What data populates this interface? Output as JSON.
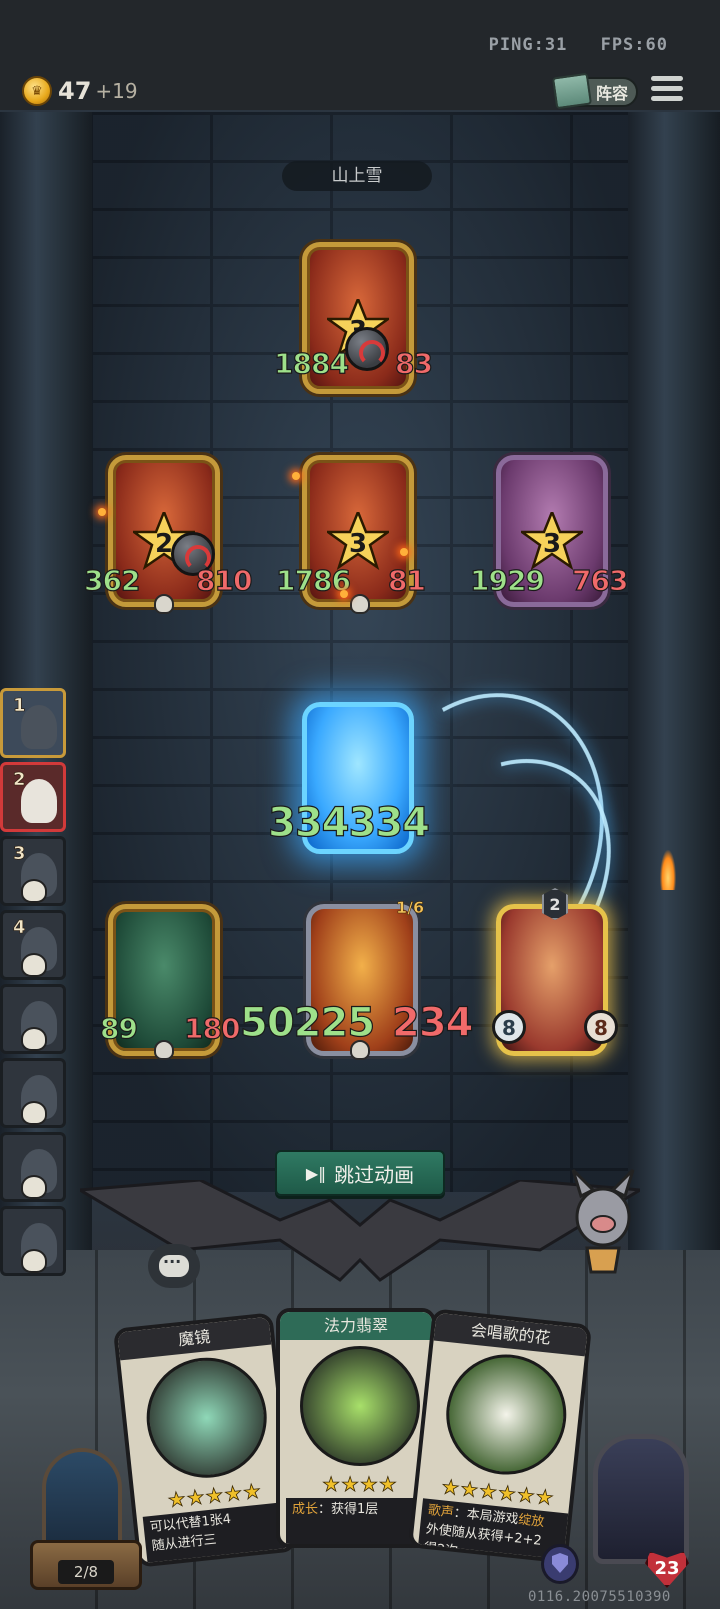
{
  "network": {
    "ping": "PING:31",
    "fps": "FPS:60"
  },
  "gold": {
    "value": "47",
    "income": "+19"
  },
  "header": {
    "lineup_label": "阵容"
  },
  "stage": {
    "name": "山上雪"
  },
  "enemies": [
    {
      "tier": "3",
      "attack": "1884",
      "health": "83"
    },
    {
      "tier": "2",
      "attack": "362",
      "health": "810"
    },
    {
      "tier": "3",
      "attack": "1786",
      "health": "81"
    },
    {
      "tier": "3",
      "attack": "1929",
      "health": "763"
    }
  ],
  "frozen_card": {
    "damage": "334334"
  },
  "allies": [
    {
      "attack": "89",
      "health": "180"
    },
    {
      "attack": "50225",
      "health": "234",
      "counter": "1/6"
    },
    {
      "attack": "8",
      "health": "8",
      "level": "2"
    }
  ],
  "roster": [
    {
      "num": "1",
      "state": "active"
    },
    {
      "num": "2",
      "state": "selected"
    },
    {
      "num": "3",
      "state": "dead"
    },
    {
      "num": "4",
      "state": "dead"
    },
    {
      "num": "",
      "state": "dead"
    },
    {
      "num": "",
      "state": "dead"
    },
    {
      "num": "",
      "state": "dead"
    },
    {
      "num": "",
      "state": "dead"
    }
  ],
  "skip_button": {
    "label": "跳过动画",
    "icon": "play-pause-icon"
  },
  "hand": [
    {
      "title": "魔镜",
      "stars": "★★★★★",
      "text_1": "可以代替1张4",
      "text_2": "随从进行三"
    },
    {
      "title": "法力翡翠",
      "stars": "★★★★",
      "keyword": "成长",
      "text_1": "：获得1层"
    },
    {
      "title": "会唱歌的花",
      "stars": "★★★★★★",
      "keyword": "歌声",
      "text_1": "：本局游戏",
      "keyword_2": "绽放",
      "text_2": "外使随从获得+2+2",
      "text_3": "得2次"
    }
  ],
  "deck": {
    "count": "2/8"
  },
  "hero": {
    "health": "23"
  },
  "build": {
    "id": "0116.20075510390"
  },
  "colors": {
    "attack": "#9ee08a",
    "health": "#f06a6a",
    "accent_gold": "#c49a3a",
    "skip_green": "#2f7a63"
  }
}
